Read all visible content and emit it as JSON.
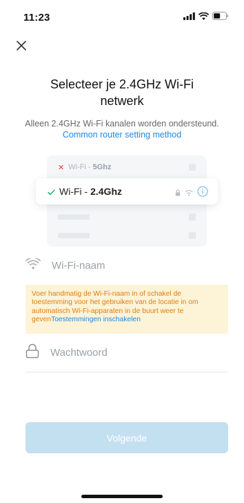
{
  "status_bar": {
    "time": "11:23",
    "icons": [
      "signal-icon",
      "wifi-icon",
      "battery-icon"
    ]
  },
  "header": {
    "close_icon": "close-icon"
  },
  "title": "Selecteer je 2.4GHz Wi-Fi netwerk",
  "subtitle": {
    "text": "Alleen 2.4GHz Wi-Fi kanalen worden ondersteund.",
    "link": "Common router setting method"
  },
  "illustration": {
    "rejected": {
      "prefix": "Wi-Fi - ",
      "band": "5Ghz",
      "status_icon": "cross-icon",
      "status_color": "#e53935"
    },
    "accepted": {
      "prefix": "Wi-Fi - ",
      "band": "2.4Ghz",
      "status_icon": "check-icon",
      "status_color": "#2bb673"
    },
    "network_icons": [
      "lock-icon",
      "wifi-icon",
      "info-icon"
    ]
  },
  "form": {
    "wifi_name": {
      "placeholder": "Wi-Fi-naam",
      "value": "",
      "icon": "wifi-icon"
    },
    "password": {
      "placeholder": "Wachtwoord",
      "value": "",
      "icon": "lock-icon"
    }
  },
  "warning": {
    "text": "Voer handmatig de Wi-Fi-naam in of schakel de toestemming voor het gebruiken van de locatie in om automatisch Wi-Fi-apparaten in de buurt weer te geven",
    "link": "Toestemmingen inschakelen"
  },
  "next_button": {
    "label": "Volgende"
  },
  "colors": {
    "accent": "#1e88e5",
    "warning_text": "#e07d12",
    "warning_bg": "#fdf3d7",
    "button_disabled": "#c3e0f1"
  }
}
